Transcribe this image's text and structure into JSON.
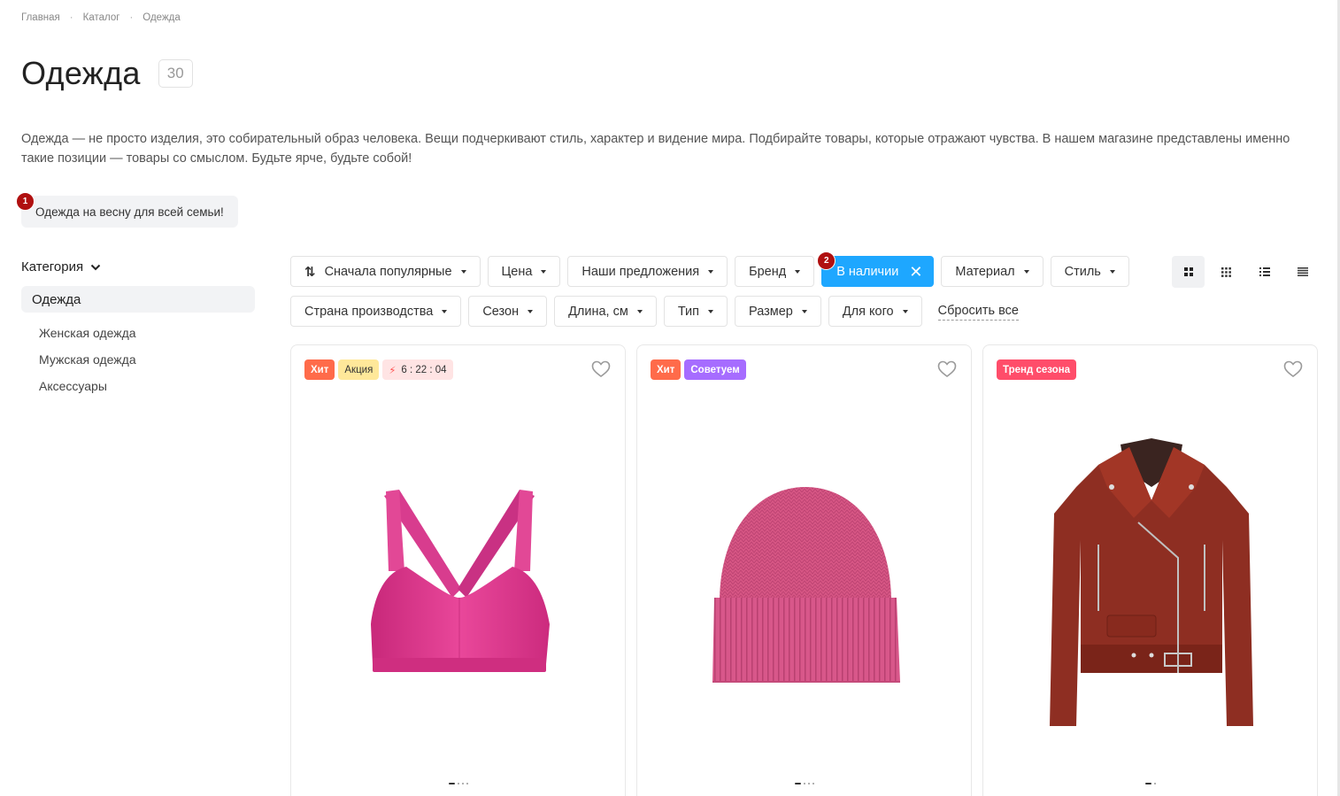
{
  "breadcrumb": [
    "Главная",
    "Каталог",
    "Одежда"
  ],
  "page": {
    "title": "Одежда",
    "count": "30",
    "description": "Одежда — не просто изделия, это собирательный образ человека. Вещи подчеркивают стиль, характер и видение мира. Подбирайте товары, которые отражают чувства. В нашем магазине представлены именно такие позиции — товары со смыслом. Будьте ярче, будьте собой!"
  },
  "promo_chip": {
    "label": "Одежда на весну для всей семьи!",
    "marker": "1"
  },
  "sidebar": {
    "heading": "Категория",
    "active": "Одежда",
    "items": [
      "Женская одежда",
      "Мужская одежда",
      "Аксессуары"
    ]
  },
  "filters": {
    "row1": [
      {
        "label": "Сначала популярные"
      },
      {
        "label": "Цена"
      },
      {
        "label": "Наши предложения"
      },
      {
        "label": "Бренд"
      },
      {
        "label": "В наличии",
        "active": true,
        "marker": "2"
      },
      {
        "label": "Материал"
      },
      {
        "label": "Стиль"
      }
    ],
    "row2": [
      {
        "label": "Страна производства"
      },
      {
        "label": "Сезон"
      },
      {
        "label": "Длина, см"
      },
      {
        "label": "Тип"
      },
      {
        "label": "Размер"
      },
      {
        "label": "Для кого"
      }
    ],
    "reset": "Сбросить все"
  },
  "view_modes": [
    "grid-large-icon",
    "grid-small-icon",
    "list-icon",
    "compact-list-icon"
  ],
  "colors": {
    "accent": "#1ea7ff",
    "marker": "#b01010",
    "hit": "#ff6b4a",
    "sale": "#ffe89a",
    "recommend": "#a66cff",
    "trend": "#ff4d6a",
    "timer": "#ffe4e4"
  },
  "products": [
    {
      "badges": [
        {
          "text": "Хит",
          "kind": "hit"
        },
        {
          "text": "Акция",
          "kind": "sale"
        },
        {
          "text": "6 : 22 : 04",
          "kind": "timer"
        }
      ],
      "image": "pink-sports-bra",
      "dots": 4
    },
    {
      "badges": [
        {
          "text": "Хит",
          "kind": "hit"
        },
        {
          "text": "Советуем",
          "kind": "recommend"
        }
      ],
      "image": "pink-knit-beanie",
      "dots": 4
    },
    {
      "badges": [
        {
          "text": "Тренд сезона",
          "kind": "trend"
        }
      ],
      "image": "red-leather-jacket",
      "dots": 2
    }
  ]
}
